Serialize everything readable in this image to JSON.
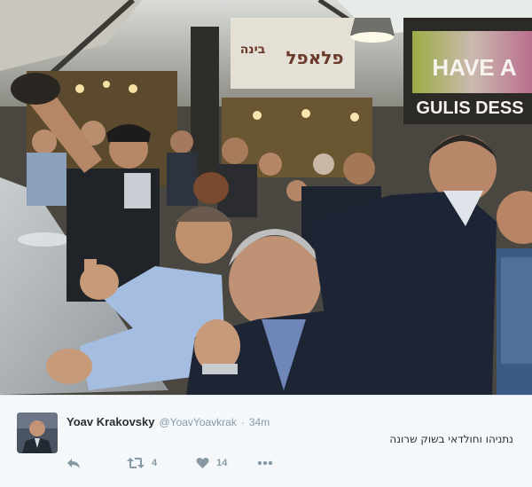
{
  "photo": {
    "signs": {
      "falafel_hebrew": "פלאפל",
      "wine_hebrew": "בינה",
      "neon_line1": "HAVE A",
      "neon_line2": "GULIS DESS"
    }
  },
  "tweet": {
    "author": {
      "display_name": "Yoav Krakovsky",
      "handle": "@YoavYoavkrak"
    },
    "separator": "·",
    "timestamp": "34m",
    "text": "נתניהו וחולדאי בשוק שרונה",
    "actions": {
      "retweet_count": "4",
      "like_count": "14"
    }
  },
  "colors": {
    "secondary_text": "#8899a6",
    "primary_text": "#292f33",
    "tweet_background": "#f5f8fa"
  },
  "icons": [
    "reply-icon",
    "retweet-icon",
    "heart-icon",
    "more-icon"
  ]
}
